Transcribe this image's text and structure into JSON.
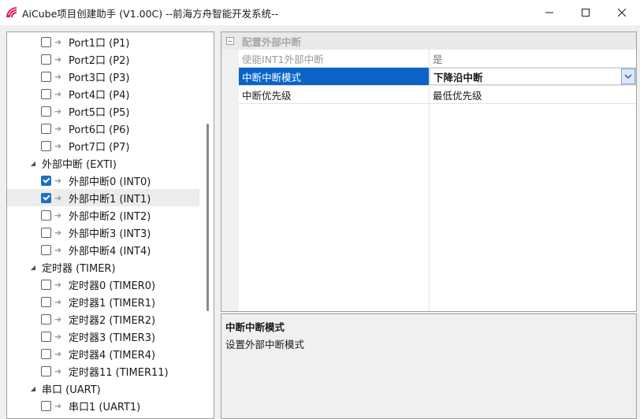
{
  "window": {
    "title": "AiCube项目创建助手 (V1.00C) --前海方舟智能开发系统--",
    "icon": "aicube-logo-icon",
    "controls": [
      "minimize-icon",
      "maximize-icon",
      "close-icon"
    ]
  },
  "tree": {
    "items": [
      {
        "level": 2,
        "label": "Port1口 (P1)",
        "checked": false
      },
      {
        "level": 2,
        "label": "Port2口 (P2)",
        "checked": false
      },
      {
        "level": 2,
        "label": "Port3口 (P3)",
        "checked": false
      },
      {
        "level": 2,
        "label": "Port4口 (P4)",
        "checked": false
      },
      {
        "level": 2,
        "label": "Port5口 (P5)",
        "checked": false
      },
      {
        "level": 2,
        "label": "Port6口 (P6)",
        "checked": false
      },
      {
        "level": 2,
        "label": "Port7口 (P7)",
        "checked": false
      },
      {
        "level": 1,
        "label": "外部中断 (EXTI)",
        "expanded": true
      },
      {
        "level": 2,
        "label": "外部中断0 (INT0)",
        "checked": true
      },
      {
        "level": 2,
        "label": "外部中断1 (INT1)",
        "checked": true,
        "highlighted": true
      },
      {
        "level": 2,
        "label": "外部中断2 (INT2)",
        "checked": false
      },
      {
        "level": 2,
        "label": "外部中断3 (INT3)",
        "checked": false
      },
      {
        "level": 2,
        "label": "外部中断4 (INT4)",
        "checked": false
      },
      {
        "level": 1,
        "label": "定时器 (TIMER)",
        "expanded": true
      },
      {
        "level": 2,
        "label": "定时器0 (TIMER0)",
        "checked": false
      },
      {
        "level": 2,
        "label": "定时器1 (TIMER1)",
        "checked": false
      },
      {
        "level": 2,
        "label": "定时器2 (TIMER2)",
        "checked": false
      },
      {
        "level": 2,
        "label": "定时器3 (TIMER3)",
        "checked": false
      },
      {
        "level": 2,
        "label": "定时器4 (TIMER4)",
        "checked": false
      },
      {
        "level": 2,
        "label": "定时器11 (TIMER11)",
        "checked": false
      },
      {
        "level": 1,
        "label": "串口 (UART)",
        "expanded": true
      },
      {
        "level": 2,
        "label": "串口1 (UART1)",
        "checked": false
      }
    ]
  },
  "property_grid": {
    "section": "配置外部中断",
    "rows": [
      {
        "name": "使能INT1外部中断",
        "value": "是",
        "enabled": false
      },
      {
        "name": "中断中断模式",
        "value": "下降沿中断",
        "selected": true
      },
      {
        "name": "中断优先级",
        "value": "最低优先级"
      }
    ]
  },
  "description": {
    "title": "中断中断模式",
    "text": "设置外部中断模式"
  },
  "colors": {
    "selection": "#0a64c8",
    "checkbox_checked": "#1f6fc5"
  }
}
